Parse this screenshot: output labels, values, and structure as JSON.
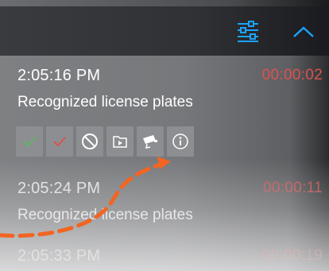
{
  "header": {
    "filter_icon": "sliders-icon",
    "collapse_icon": "chevron-up-icon",
    "accent_color": "#1aa3ff"
  },
  "events": [
    {
      "time": "2:05:16 PM",
      "description": "Recognized license plates",
      "duration": "00:00:02"
    },
    {
      "time": "2:05:24 PM",
      "description": "Recognized license plates",
      "duration": "00:00:11"
    },
    {
      "time": "2:05:33 PM",
      "description": "",
      "duration": "00:00:19"
    }
  ],
  "actions": [
    {
      "icon": "checkmark-green-icon",
      "color": "#5cb85c"
    },
    {
      "icon": "checkmark-red-icon",
      "color": "#d9534f"
    },
    {
      "icon": "block-icon"
    },
    {
      "icon": "folder-play-icon"
    },
    {
      "icon": "camera-icon"
    },
    {
      "icon": "info-icon"
    }
  ],
  "colors": {
    "duration": "#d9534f",
    "annotation_arrow": "#f26522"
  }
}
